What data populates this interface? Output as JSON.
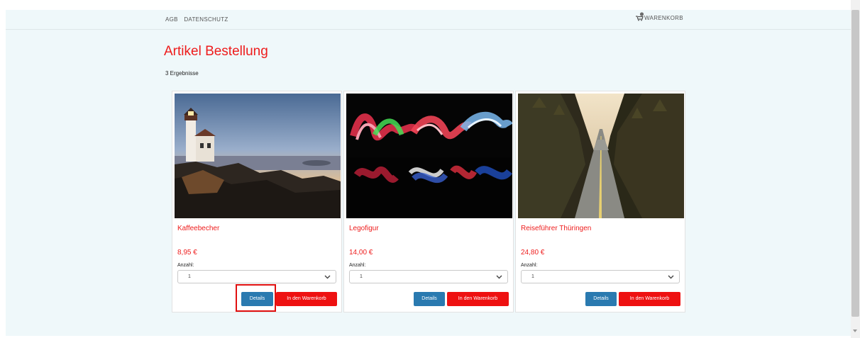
{
  "nav": {
    "agb": "AGB",
    "datenschutz": "DATENSCHUTZ",
    "cart": "WARENKORB"
  },
  "page": {
    "title": "Artikel Bestellung",
    "result_count": "3 Ergebnisse"
  },
  "products": [
    {
      "name": "Kaffeebecher",
      "price": "8,95 €",
      "qty_label": "Anzahl:",
      "qty_value": "1",
      "details_label": "Details",
      "cart_label": "In den Warenkorb",
      "image": "lighthouse-photo"
    },
    {
      "name": "Legofigur",
      "price": "14,00 €",
      "qty_label": "Anzahl:",
      "qty_value": "1",
      "details_label": "Details",
      "cart_label": "In den Warenkorb",
      "image": "light-painting-photo"
    },
    {
      "name": "Reiseführer Thüringen",
      "price": "24,80 €",
      "qty_label": "Anzahl:",
      "qty_value": "1",
      "details_label": "Details",
      "cart_label": "In den Warenkorb",
      "image": "forest-road-photo"
    }
  ],
  "colors": {
    "accent_red": "#ee1c1c",
    "button_blue": "#2a7ab0",
    "button_red": "#ee1111",
    "page_bg": "#eff8fa"
  }
}
